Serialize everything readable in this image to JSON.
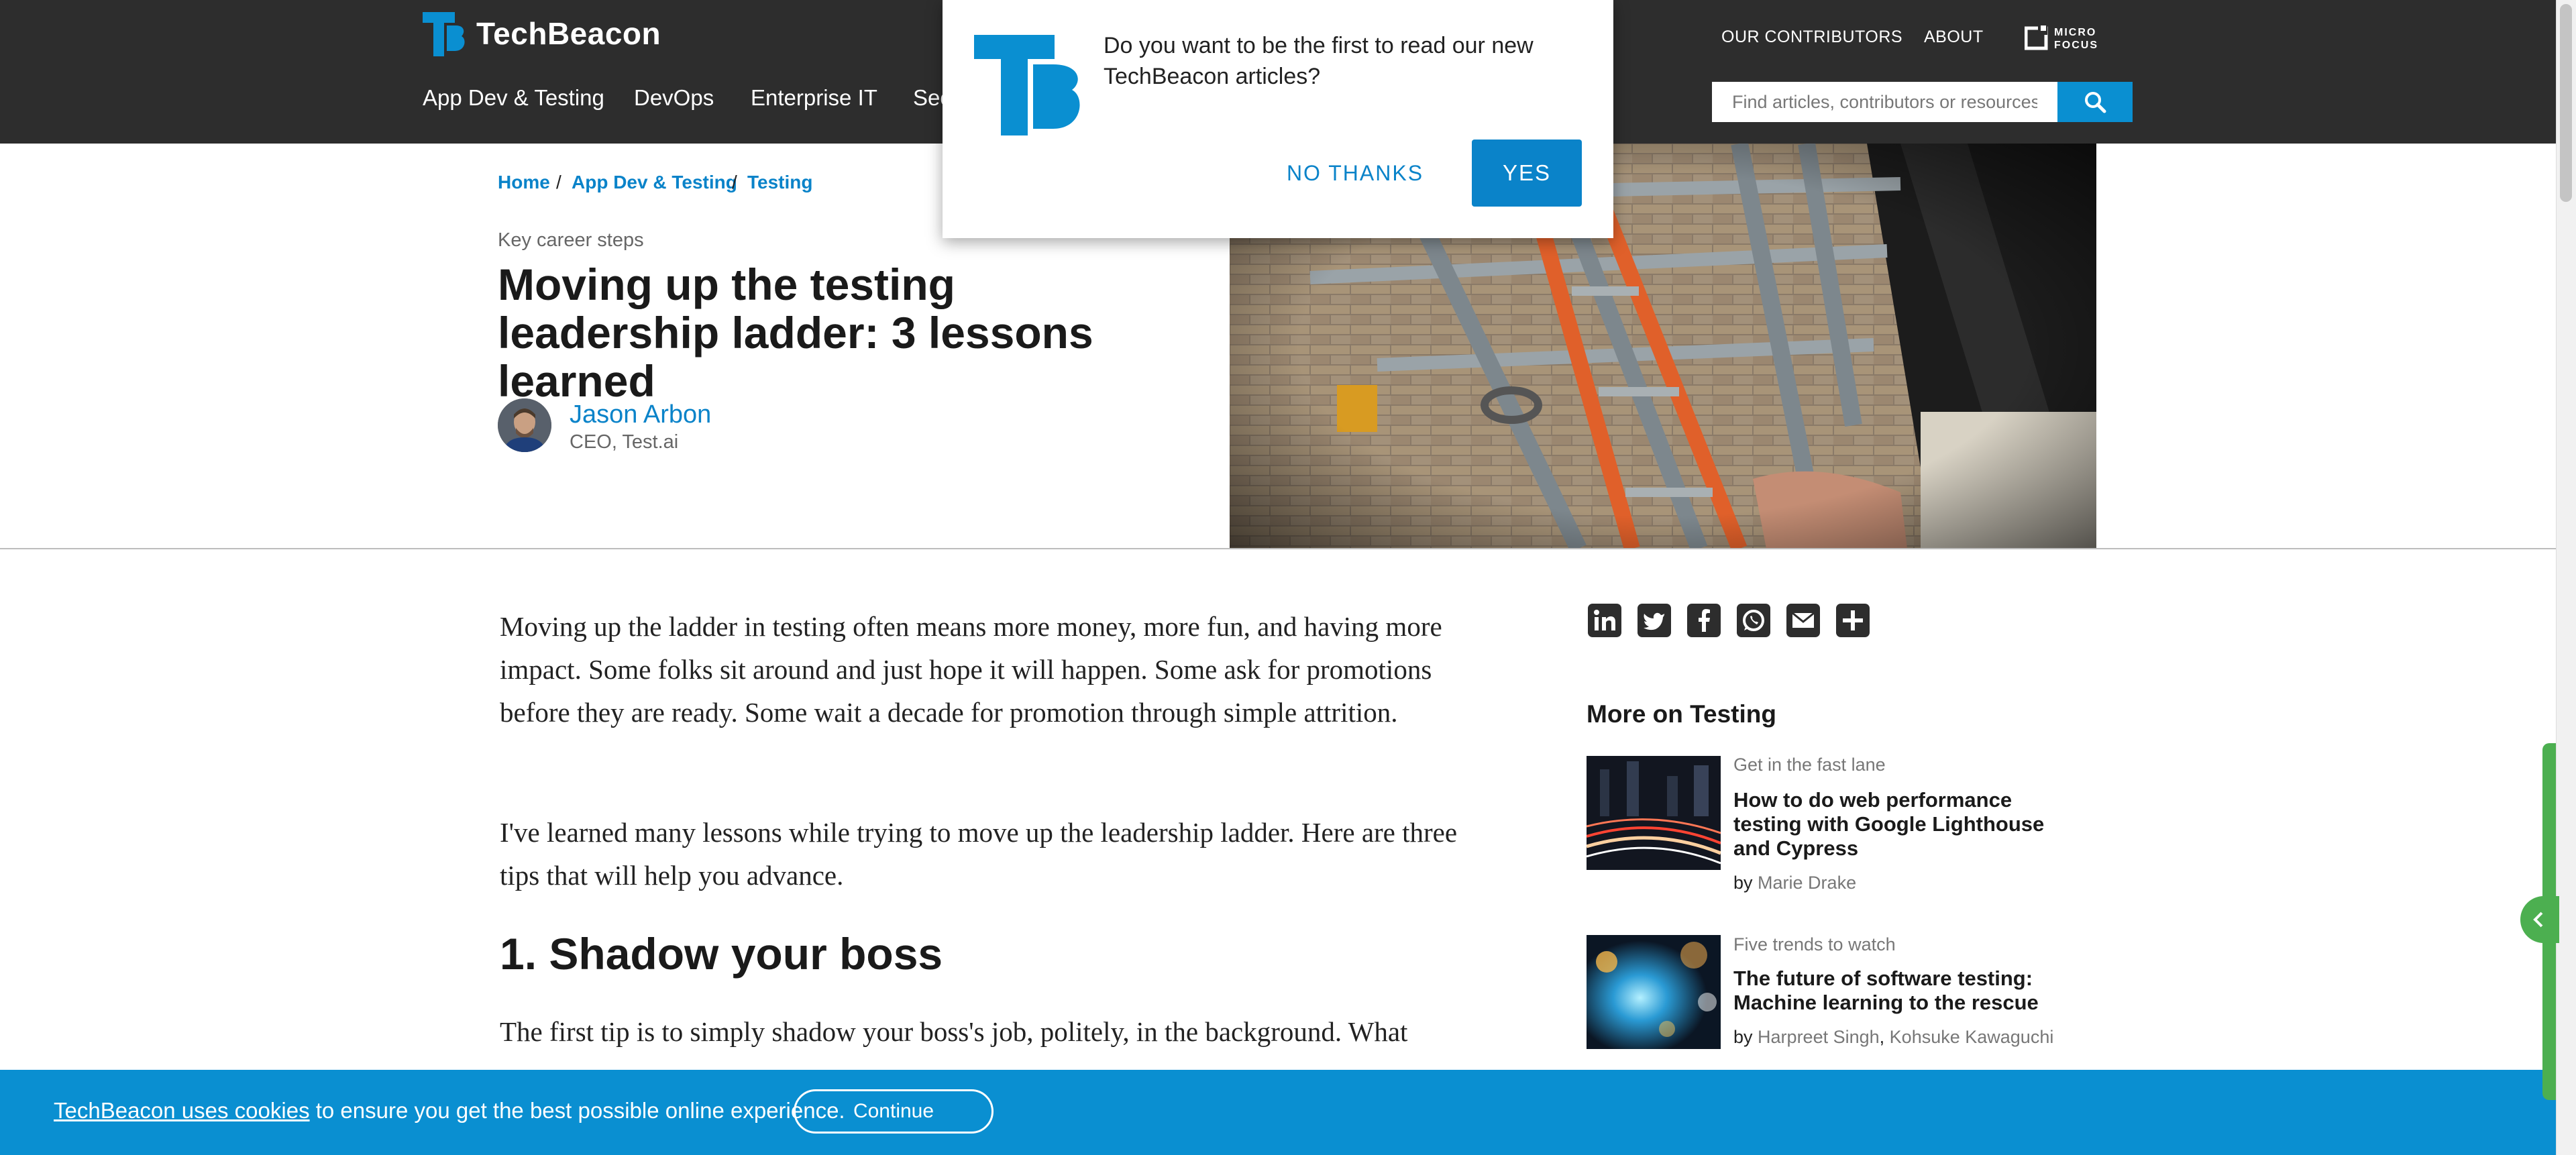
{
  "header": {
    "brand": "TechBeacon",
    "nav": [
      "App Dev & Testing",
      "DevOps",
      "Enterprise IT",
      "Sec"
    ],
    "top_links": [
      "OUR CONTRIBUTORS",
      "ABOUT"
    ],
    "search_placeholder": "Find articles, contributors or resources",
    "partner_logo": "MICRO FOCUS"
  },
  "breadcrumb": [
    "Home",
    "App Dev & Testing",
    "Testing"
  ],
  "article": {
    "kicker": "Key career steps",
    "title": "Moving up the testing leadership ladder: 3 lessons learned",
    "author": {
      "name": "Jason Arbon",
      "title": "CEO, Test.ai"
    },
    "paragraphs": [
      "Moving up the ladder in testing often means more money, more fun, and having more impact. Some folks sit around and just hope it will happen. Some ask for promotions before they are ready. Some wait a decade for promotion through simple attrition.",
      "I've learned many lessons while trying to move up the leadership ladder. Here are three tips that will help you advance."
    ],
    "heading": "1. Shadow your boss",
    "paragraph3": "The first tip is to simply shadow your boss's job, politely, in the background. What"
  },
  "sidebar": {
    "share_icons": [
      "linkedin-icon",
      "twitter-icon",
      "facebook-icon",
      "whatsapp-icon",
      "email-icon",
      "plus-icon"
    ],
    "more_heading": "More on Testing",
    "cards": [
      {
        "kicker": "Get in the fast lane",
        "title": "How to do web performance testing with Google Lighthouse and Cypress",
        "by": "by",
        "authors": [
          "Marie Drake"
        ]
      },
      {
        "kicker": "Five trends to watch",
        "title": "The future of software testing: Machine learning to the rescue",
        "by": "by",
        "authors": [
          "Harpreet Singh",
          "Kohsuke Kawaguchi"
        ]
      }
    ]
  },
  "popup": {
    "message": "Do you want to be the first to read our new TechBeacon articles?",
    "no_label": "NO THANKS",
    "yes_label": "YES"
  },
  "cookie": {
    "link_text": "TechBeacon uses cookies",
    "text": " to ensure you get the best possible online experience.",
    "button": "Continue"
  },
  "colors": {
    "header_bg": "#2d2d2d",
    "accent": "#0a83c9",
    "cookie_bg": "#0a8fd1",
    "feedback_tab": "#4caf50"
  }
}
